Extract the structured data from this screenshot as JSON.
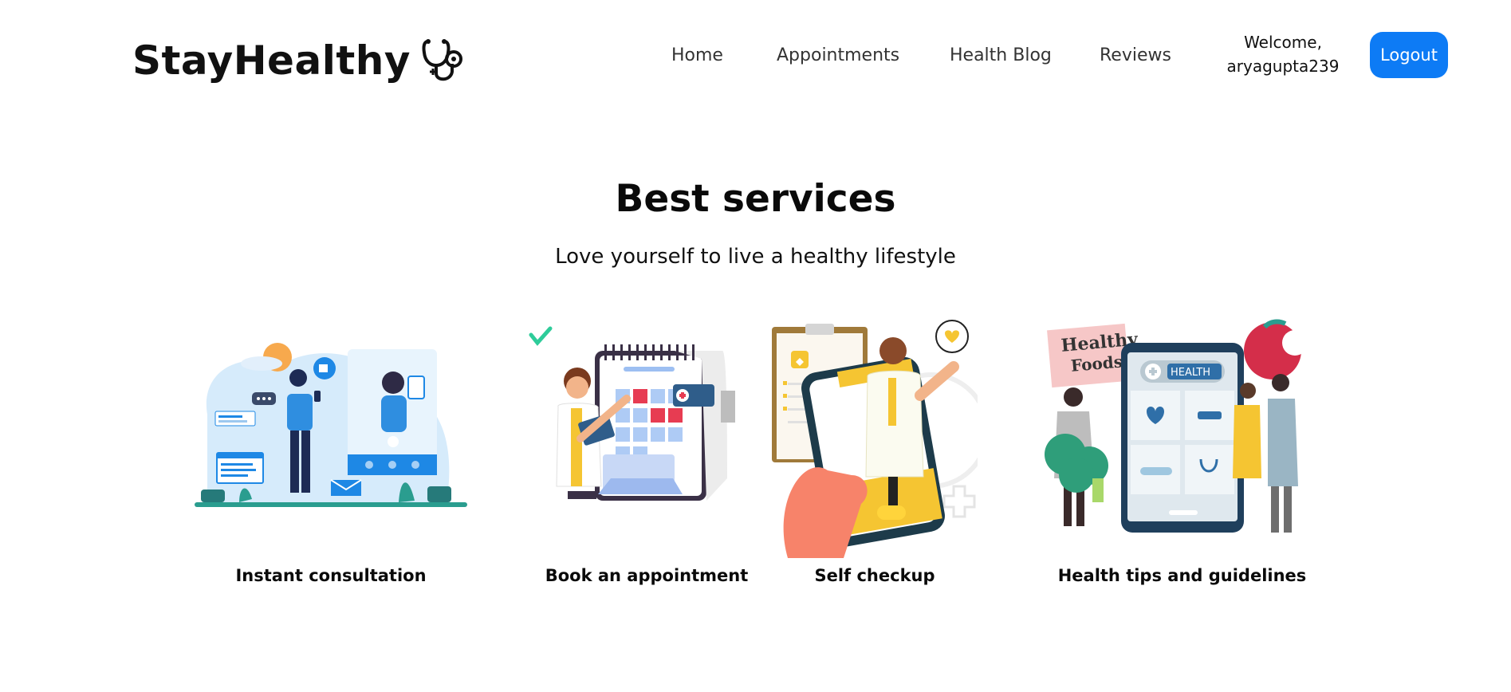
{
  "navbar": {
    "brand": "StayHealthy",
    "brand_icon": "stethoscope-icon",
    "links": [
      "Home",
      "Appointments",
      "Health Blog",
      "Reviews"
    ],
    "welcome_line1": "Welcome,",
    "welcome_line2": "aryagupta239",
    "logout_label": "Logout",
    "accent_color": "#0d7bf5"
  },
  "hero": {
    "title": "Best services",
    "subtitle": "Love yourself to live a healthy lifestyle"
  },
  "services": [
    {
      "label": "Instant consultation",
      "illustration": "video-consultation-illustration"
    },
    {
      "label": "Book an appointment",
      "illustration": "calendar-booking-illustration"
    },
    {
      "label": "Self checkup",
      "illustration": "phone-doctor-illustration"
    },
    {
      "label": "Health tips and guidelines",
      "illustration": "healthy-foods-illustration",
      "sign_text_1": "Healthy",
      "sign_text_2": "Foods",
      "screen_text": "HEALTH"
    }
  ]
}
